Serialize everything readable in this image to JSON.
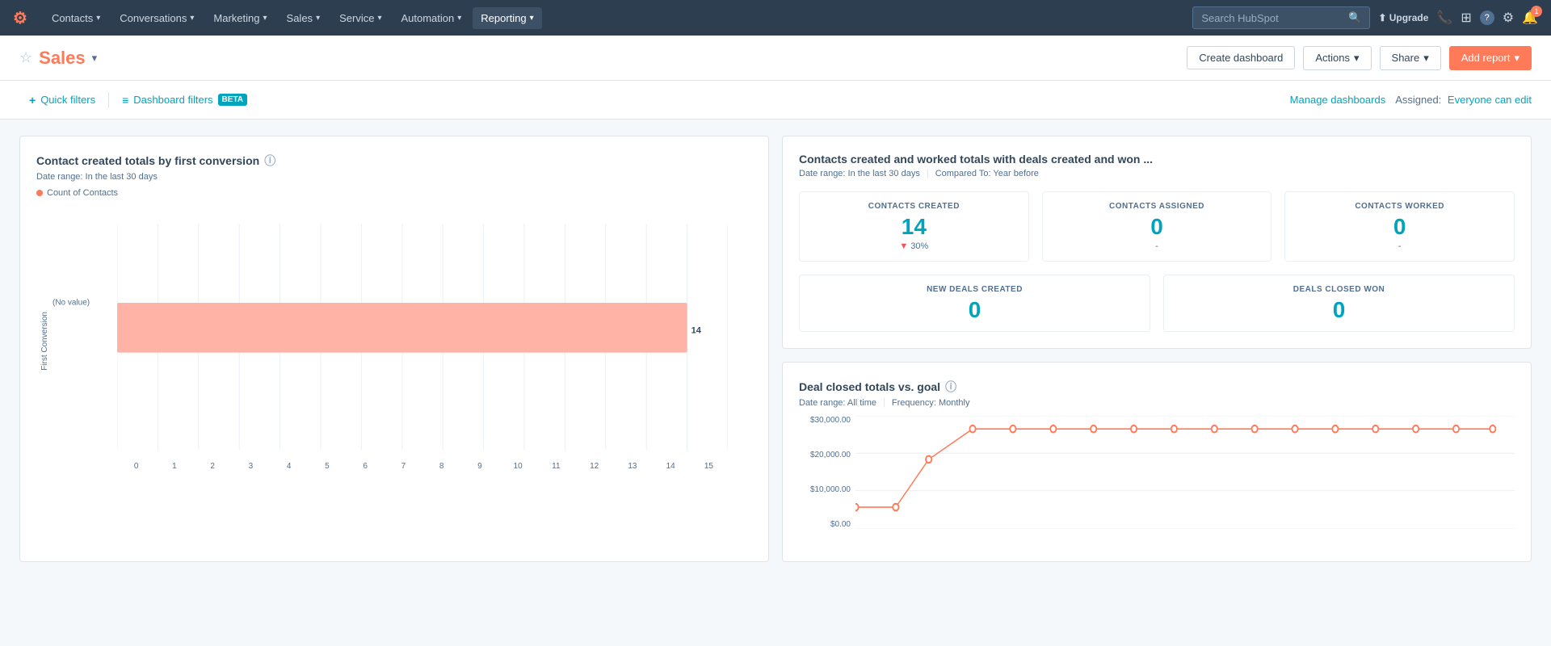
{
  "nav": {
    "logo": "⚙",
    "links": [
      {
        "label": "Contacts",
        "active": false
      },
      {
        "label": "Conversations",
        "active": false
      },
      {
        "label": "Marketing",
        "active": false
      },
      {
        "label": "Sales",
        "active": false
      },
      {
        "label": "Service",
        "active": false
      },
      {
        "label": "Automation",
        "active": false
      },
      {
        "label": "Reporting",
        "active": true
      }
    ],
    "search_placeholder": "Search HubSpot",
    "notification_count": "1"
  },
  "header": {
    "star_label": "☆",
    "title": "Sales",
    "caret": "▾",
    "create_dashboard": "Create dashboard",
    "actions": "Actions",
    "share": "Share",
    "add_report": "Add report"
  },
  "filters": {
    "quick_filters_label": "Quick filters",
    "dashboard_filters_label": "Dashboard filters",
    "beta_badge": "BETA",
    "manage_dashboards": "Manage dashboards",
    "assigned_label": "Assigned:",
    "everyone_can_edit": "Everyone can edit"
  },
  "contact_chart": {
    "title": "Contact created totals by first conversion",
    "date_range": "Date range: In the last 30 days",
    "legend_label": "Count of Contacts",
    "y_axis_label": "First Conversion",
    "bar_label": "(No value)",
    "bar_value": "14",
    "bar_width_pct": 93,
    "x_ticks": [
      "0",
      "1",
      "2",
      "3",
      "4",
      "5",
      "6",
      "7",
      "8",
      "9",
      "10",
      "11",
      "12",
      "13",
      "14",
      "15"
    ]
  },
  "contacts_metrics": {
    "title": "Contacts created and worked totals with deals created and won ...",
    "date_range": "Date range: In the last 30 days",
    "compared_to": "Compared To: Year before",
    "metrics_top": [
      {
        "label": "CONTACTS CREATED",
        "value": "14",
        "change": "▼ 30%",
        "has_change": true
      },
      {
        "label": "CONTACTS ASSIGNED",
        "value": "0",
        "change": "-",
        "has_change": false
      },
      {
        "label": "CONTACTS WORKED",
        "value": "0",
        "change": "-",
        "has_change": false
      }
    ],
    "metrics_bottom": [
      {
        "label": "NEW DEALS CREATED",
        "value": "0"
      },
      {
        "label": "DEALS CLOSED WON",
        "value": "0"
      }
    ]
  },
  "deal_chart": {
    "title": "Deal closed totals vs. goal",
    "date_range": "Date range: All time",
    "frequency": "Frequency: Monthly",
    "y_labels": [
      "$30,000.00",
      "$20,000.00",
      "$10,000.00",
      "$0.00"
    ],
    "line_points": [
      {
        "x": 0,
        "y": 75
      },
      {
        "x": 60,
        "y": 75
      },
      {
        "x": 90,
        "y": 30
      },
      {
        "x": 140,
        "y": 8
      },
      {
        "x": 195,
        "y": 8
      },
      {
        "x": 250,
        "y": 8
      },
      {
        "x": 305,
        "y": 8
      },
      {
        "x": 360,
        "y": 8
      },
      {
        "x": 415,
        "y": 8
      },
      {
        "x": 470,
        "y": 8
      },
      {
        "x": 525,
        "y": 8
      },
      {
        "x": 580,
        "y": 8
      },
      {
        "x": 635,
        "y": 8
      },
      {
        "x": 690,
        "y": 8
      },
      {
        "x": 745,
        "y": 8
      },
      {
        "x": 800,
        "y": 8
      },
      {
        "x": 850,
        "y": 8
      }
    ]
  },
  "icons": {
    "search": "🔍",
    "upgrade": "⬆",
    "phone": "📞",
    "marketplace": "🏪",
    "help": "?",
    "settings": "⚙",
    "notification": "🔔",
    "plus": "+",
    "filter": "≡",
    "info": "ⓘ"
  }
}
